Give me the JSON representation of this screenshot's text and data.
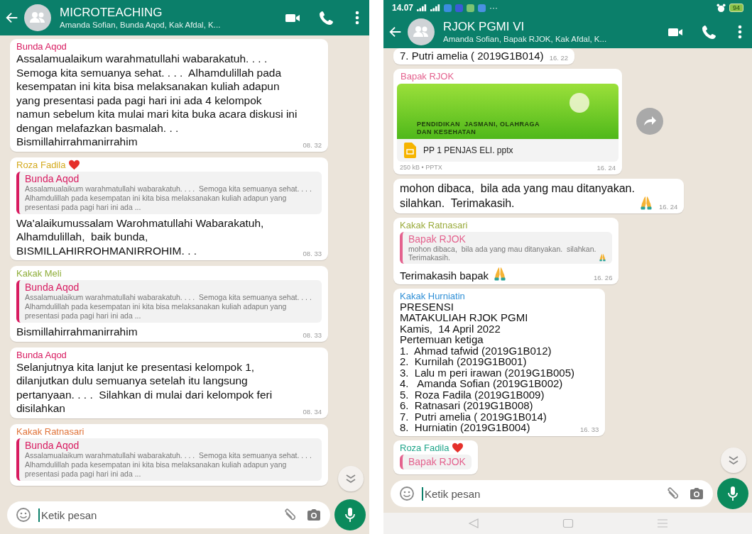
{
  "phones": [
    {
      "header": {
        "title": "MICROTEACHING",
        "subtitle": "Amanda Sofian,  Bunda Aqod,  Kak Afdal,  K..."
      },
      "messages": [
        {
          "kind": "text",
          "sender": "Bunda Aqod",
          "color": "#d81b60",
          "text": "Assalamualaikum warahmatullahi wabarakatuh. . . .  Semoga kita semuanya sehat. . . .  Alhamdulillah pada kesempatan ini kita bisa melaksanakan kuliah adapun yang presentasi pada pagi hari ini ada 4 kelompok namun sebelum kita mulai mari kita buka acara diskusi ini dengan melafazkan basmalah. . . Bismillahirrahmanirrahim",
          "time": "08. 32"
        },
        {
          "kind": "text",
          "sender": "Roza Fadila",
          "color": "#d4aa1e",
          "heart": true,
          "quote": {
            "sender": "Bunda Aqod",
            "color": "#d81b60",
            "text": "Assalamualaikum warahmatullahi wabarakatuh. . . .  Semoga kita semuanya sehat. . . .  Alhamdulillah pada kesempatan ini kita bisa melaksanakan kuliah adapun yang presentasi pada pagi hari ini ada ..."
          },
          "text": "Wa'alaikumussalam Warohmatullahi Wabarakatuh,  Alhamdulillah,  baik bunda, BISMILLAHIRROHMANIRROHIM. . .",
          "time": "08. 33"
        },
        {
          "kind": "text",
          "sender": "Kakak Meli",
          "color": "#8fae3a",
          "quote": {
            "sender": "Bunda Aqod",
            "color": "#d81b60",
            "text": "Assalamualaikum warahmatullahi wabarakatuh. . . .  Semoga kita semuanya sehat. . . .  Alhamdulillah pada kesempatan ini kita bisa melaksanakan kuliah adapun yang presentasi pada pagi hari ini ada ..."
          },
          "text": "Bismillahirrahmanirrahim",
          "time": "08. 33"
        },
        {
          "kind": "text",
          "sender": "Bunda Aqod",
          "color": "#d81b60",
          "text": "Selanjutnya kita lanjut ke presentasi kelompok 1, dilanjutkan dulu semuanya setelah itu langsung pertanyaan. . . .  Silahkan di mulai dari kelompok feri disilahkan",
          "time": "08. 34"
        },
        {
          "kind": "text",
          "sender": "Kakak Ratnasari",
          "color": "#e0743a",
          "quote": {
            "sender": "Bunda Aqod",
            "color": "#d81b60",
            "text": "Assalamualaikum warahmatullahi wabarakatuh. . . .  Semoga kita semuanya sehat. . . .  Alhamdulillah pada kesempatan ini kita bisa melaksanakan kuliah adapun yang presentasi pada pagi hari ini ada ..."
          }
        }
      ],
      "input": {
        "placeholder": "Ketik pesan"
      }
    },
    {
      "status_bar": {
        "time": "14.07",
        "more": "···",
        "battery": "94"
      },
      "header": {
        "title": "RJOK PGMI VI",
        "subtitle": "Amanda Sofian,  Bapak RJOK,  Kak Afdal,  K..."
      },
      "messages": [
        {
          "kind": "text",
          "text": "7. Putri amelia ( 2019G1B014)",
          "time": "16. 22"
        },
        {
          "kind": "document",
          "sender": "Bapak RJOK",
          "color": "#e4628e",
          "preview_title": "PENDIDIKAN  JASMANI, OLAHRAGA\nDAN KESEHATAN",
          "file_name": "PP 1 PENJAS ELI. pptx",
          "file_meta": "250 kB • PPTX",
          "time": "16. 24"
        },
        {
          "kind": "text",
          "text": "mohon dibaca,  bila ada yang mau ditanyakan.\nsilahkan.  Terimakasih.",
          "pray_emoji": true,
          "time": "16. 24"
        },
        {
          "kind": "text",
          "sender": "Kakak Ratnasari",
          "color": "#9aab3c",
          "quote": {
            "sender": "Bapak RJOK",
            "color": "#e4628e",
            "text": "mohon dibaca,  bila ada yang mau ditanyakan.  silahkan.\nTerimakasih.",
            "pray_emoji": true
          },
          "text": "Terimakasih bapak",
          "pray_emoji": true,
          "time": "16. 26"
        },
        {
          "kind": "text",
          "sender": "Kakak Hurniatin",
          "color": "#2f8fd6",
          "text": "PRESENSI\nMATAKULIAH RJOK PGMI\nKamis,  14 April 2022\nPertemuan ketiga\n1.  Ahmad tafwid (2019G1B012)\n2.  Kurnilah (2019G1B001)\n3.  Lalu m peri irawan (2019G1B005)\n4.   Amanda Sofian (2019G1B002)\n5.  Roza Fadila (2019G1B009)\n6.  Ratnasari (2019G1B008)\n7.  Putri amelia ( 2019G1B014)\n8.  Hurniatin (2019G1B004)",
          "time": "16. 33"
        },
        {
          "kind": "text",
          "sender": "Roza Fadila",
          "color": "#1fa58a",
          "heart": true,
          "quote": {
            "sender": "Bapak RJOK",
            "color": "#e4628e"
          }
        }
      ],
      "input": {
        "placeholder": "Ketik pesan"
      },
      "nav_bar": true
    }
  ]
}
